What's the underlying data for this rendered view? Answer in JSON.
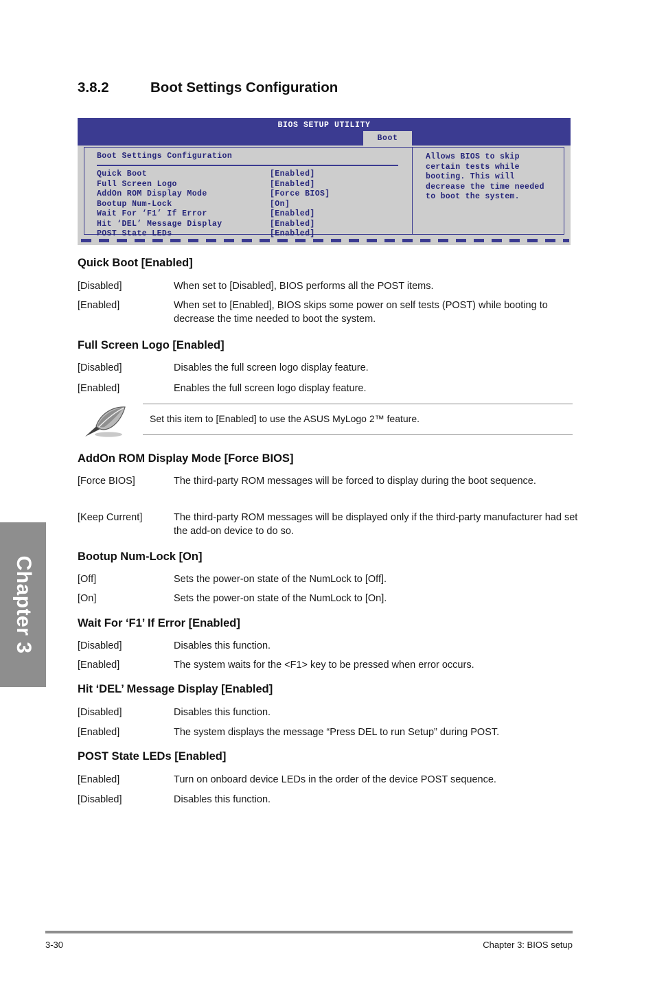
{
  "chapter_tab": {
    "label": "Chapter 3"
  },
  "heading": {
    "number": "3.8.2",
    "title": "Boot Settings Configuration"
  },
  "bios_screen": {
    "title": "BIOS SETUP UTILITY",
    "active_tab": "Boot",
    "section_title": "Boot Settings Configuration",
    "items": [
      {
        "name": "Quick Boot",
        "value": "[Enabled]"
      },
      {
        "name": "Full Screen Logo",
        "value": "[Enabled]"
      },
      {
        "name": "AddOn ROM Display Mode",
        "value": "[Force BIOS]"
      },
      {
        "name": "Bootup Num-Lock",
        "value": "[On]"
      },
      {
        "name": "Wait For ‘F1’ If Error",
        "value": "[Enabled]"
      },
      {
        "name": "Hit ‘DEL’ Message Display",
        "value": "[Enabled]"
      },
      {
        "name": "POST State LEDs",
        "value": "[Enabled]"
      }
    ],
    "help_text": "Allows BIOS to skip certain tests while booting. This will decrease the time needed to boot the system.",
    "colors": {
      "titlebar_blue": "#3b3b91",
      "panel_gray": "#cdcdcd",
      "text_blue": "#26267a"
    }
  },
  "sections": [
    {
      "heading": "Quick Boot [Enabled]",
      "rows": [
        {
          "key": "[Disabled]",
          "desc": "When set to [Disabled], BIOS performs all the POST items."
        },
        {
          "key": "[Enabled]",
          "desc": "When set to [Enabled], BIOS skips some power on self tests (POST) while booting to decrease the time needed to boot the system."
        }
      ]
    },
    {
      "heading": "Full Screen Logo [Enabled]",
      "rows": [
        {
          "key": "[Disabled]",
          "desc": "Disables the full screen logo display feature."
        },
        {
          "key": "[Enabled]",
          "desc": "Enables the full screen logo display feature."
        }
      ]
    },
    {
      "heading": "AddOn ROM Display Mode [Force BIOS]",
      "rows": [
        {
          "key": "[Force BIOS]",
          "desc": "The third-party ROM messages will be forced to display during the boot sequence."
        },
        {
          "key": "[Keep Current]",
          "desc": "The third-party ROM messages will be displayed only if the third-party manufacturer had set the add-on device to do so."
        }
      ]
    },
    {
      "heading": "Bootup Num-Lock [On]",
      "rows": [
        {
          "key": "[Off]",
          "desc": "Sets the power-on state of the NumLock to [Off]."
        },
        {
          "key": "[On]",
          "desc": "Sets the power-on state of the NumLock to [On]."
        }
      ]
    },
    {
      "heading": "Wait For ‘F1’ If Error [Enabled]",
      "rows": [
        {
          "key": "[Disabled]",
          "desc": "Disables this function."
        },
        {
          "key": "[Enabled]",
          "desc": "The system waits for the <F1> key to be pressed when error occurs."
        }
      ]
    },
    {
      "heading": "Hit ‘DEL’ Message Display [Enabled]",
      "rows": [
        {
          "key": "[Disabled]",
          "desc": "Disables this function."
        },
        {
          "key": "[Enabled]",
          "desc": "The system displays the message “Press DEL to run Setup” during POST."
        }
      ]
    },
    {
      "heading": "POST State LEDs [Enabled]",
      "rows": [
        {
          "key": "[Enabled]",
          "desc": "Turn on onboard device LEDs in the order of the device POST sequence."
        },
        {
          "key": "[Disabled]",
          "desc": "Disables this function."
        }
      ]
    }
  ],
  "note": {
    "icon": "quill-pen-icon",
    "text": "Set this item to [Enabled] to use the ASUS MyLogo 2™ feature."
  },
  "footer": {
    "page_number": "3-30",
    "chapter_label": "Chapter 3: BIOS setup"
  }
}
